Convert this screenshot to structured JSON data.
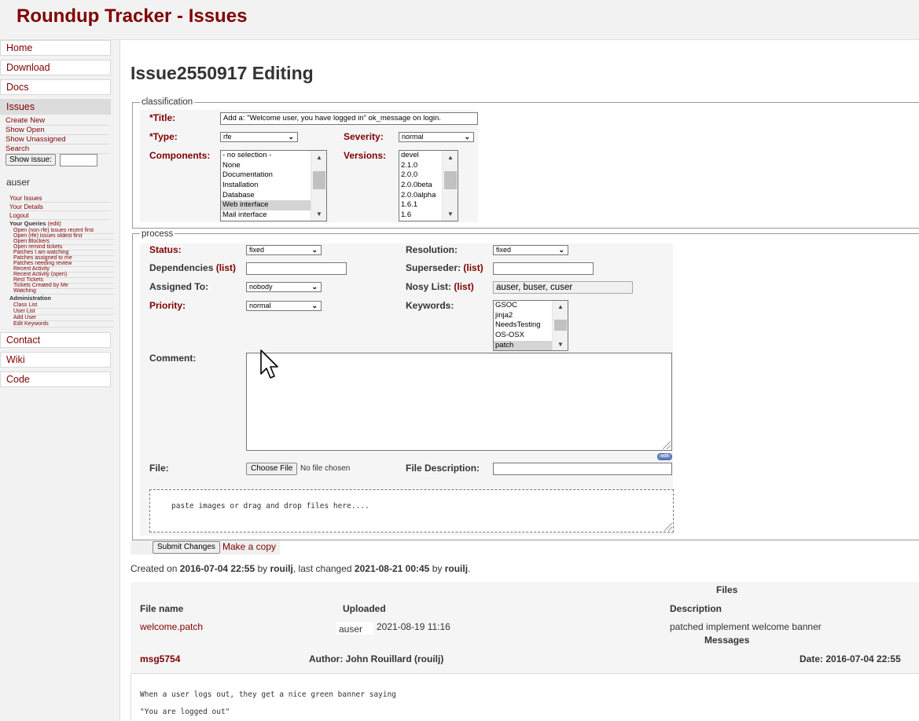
{
  "app": {
    "title": "Roundup Tracker - Issues"
  },
  "sidebar": {
    "nav_top": [
      "Home",
      "Download",
      "Docs",
      "Issues"
    ],
    "issue_links": [
      "Create New",
      "Show Open",
      "Show Unassigned",
      "Search"
    ],
    "show_issue_button": "Show issue:",
    "username": "auser",
    "user_links": [
      "Your Issues",
      "Your Details",
      "Logout"
    ],
    "queries_header": "Your Queries",
    "queries_edit": "(edit)",
    "queries": [
      "Open (non rfe) issues recent first",
      "Open (rfe) issues oldest first",
      "Open Blockers",
      "Open remind tickets",
      "Patches I am watching",
      "Patches assigned to me",
      "Patches needing review",
      "Recent Activity",
      "Recent Activity (open)",
      "Rest Tickets",
      "Tickets Created by Me",
      "Watching"
    ],
    "admin_header": "Administration",
    "admin_links": [
      "Class List",
      "User List",
      "Add User",
      "Edit Keywords"
    ],
    "nav_bottom": [
      "Contact",
      "Wiki",
      "Code"
    ]
  },
  "page": {
    "title": "Issue2550917 Editing"
  },
  "classification": {
    "legend": "classification",
    "title_label": "*Title:",
    "title_value": "Add a: \"Welcome user, you have logged in\" ok_message on login.",
    "type_label": "*Type:",
    "type_value": "rfe",
    "severity_label": "Severity:",
    "severity_value": "normal",
    "components_label": "Components:",
    "components_options": [
      "- no selection -",
      "None",
      "Documentation",
      "Installation",
      "Database",
      "Web interface",
      "Mail interface"
    ],
    "components_selected": "Web interface",
    "versions_label": "Versions:",
    "versions_options": [
      "devel",
      "2.1.0",
      "2.0.0",
      "2.0.0beta",
      "2.0.0alpha",
      "1.6.1",
      "1.6"
    ]
  },
  "process": {
    "legend": "process",
    "status_label": "Status:",
    "status_value": "fixed",
    "resolution_label": "Resolution:",
    "resolution_value": "fixed",
    "dependencies_label": "Dependencies",
    "superseder_label": "Superseder:",
    "list_link": "(list)",
    "assigned_label": "Assigned To:",
    "assigned_value": "nobody",
    "nosy_label": "Nosy List:",
    "nosy_value": "auser, buser, cuser",
    "priority_label": "Priority:",
    "priority_value": "normal",
    "keywords_label": "Keywords:",
    "keywords_options": [
      "GSOC",
      "jinja2",
      "NeedsTesting",
      "OS-OSX",
      "patch"
    ],
    "keywords_selected": "patch",
    "comment_label": "Comment:",
    "edit_badge": "edit",
    "file_label": "File:",
    "choose_file_button": "Choose File",
    "no_file_text": "No file chosen",
    "file_description_label": "File Description:",
    "dropzone_text": "paste images or drag and drop files here...."
  },
  "actions": {
    "submit": "Submit Changes",
    "copy": "Make a copy"
  },
  "history": {
    "created_prefix": "Created on",
    "created_date": "2016-07-04 22:55",
    "by1": "by",
    "creator": "rouilj",
    "changed_mid": ", last changed",
    "changed_date": "2021-08-21 00:45",
    "by2": "by",
    "changer": "rouilj",
    "period": "."
  },
  "files": {
    "heading": "Files",
    "col_name": "File name",
    "col_uploaded": "Uploaded",
    "col_description": "Description",
    "rows": [
      {
        "name": "welcome.patch",
        "user": "auser",
        "date": "2021-08-19 11:16",
        "description": "patched implement welcome banner"
      }
    ]
  },
  "messages": {
    "heading": "Messages",
    "id": "msg5754",
    "author": "Author: John Rouillard (rouilj)",
    "date": "Date: 2016-07-04 22:55",
    "lines": [
      "When a user logs out, they get a nice green banner saying",
      "\"You are logged out\""
    ]
  }
}
